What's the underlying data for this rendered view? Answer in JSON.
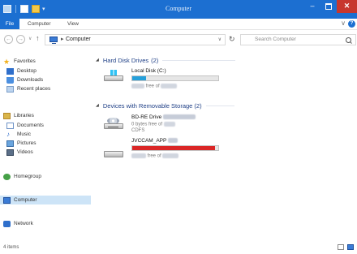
{
  "window": {
    "title": "Computer",
    "min": "–",
    "close": "✕"
  },
  "ribbon": {
    "file": "File",
    "computer": "Computer",
    "view": "View",
    "expand": "∨",
    "help": "?"
  },
  "address": {
    "back": "←",
    "forward": "→",
    "recent": "∨",
    "up": "↑",
    "crumb_arrow": "▸",
    "path": "Computer",
    "dropdown": "∨",
    "refresh": "↻",
    "search_placeholder": "Search Computer"
  },
  "nav": {
    "favorites": "Favorites",
    "desktop": "Desktop",
    "downloads": "Downloads",
    "recent": "Recent places",
    "libraries": "Libraries",
    "documents": "Documents",
    "music": "Music",
    "pictures": "Pictures",
    "videos": "Videos",
    "homegroup": "Homegroup",
    "computer": "Computer",
    "network": "Network",
    "star": "★",
    "note": "♪"
  },
  "content": {
    "hdd_group": "Hard Disk Drives",
    "hdd_count": "(2)",
    "removable_group": "Devices with Removable Storage (2)",
    "caret": "◢",
    "local_disk": {
      "name": "Local Disk (C:)",
      "free_mid": "free of",
      "used_fraction": 0.16,
      "color": "#26a0da"
    },
    "bdre": {
      "name": "BD-RE Drive",
      "free_line": "0 bytes free of",
      "fs": "CDFS"
    },
    "vdcam": {
      "name": "JVCCAM_APP",
      "free_mid": "free of",
      "used_fraction": 0.96,
      "color": "#da2626"
    }
  },
  "status": {
    "items": "4 items"
  }
}
